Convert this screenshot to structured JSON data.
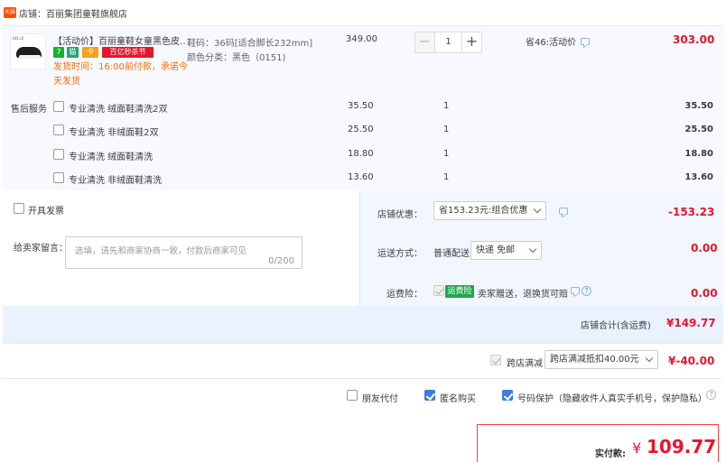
{
  "store": {
    "icon_text": "天猫",
    "label": "店铺：百丽集团童鞋旗舰店"
  },
  "item": {
    "title": "【活动价】百丽童鞋女童黑色皮…",
    "brand_mark": "BELLE",
    "badges": [
      "7",
      "猫",
      "卡",
      "百亿秒杀节"
    ],
    "ship_note": "发货时间：16:00前付款，承诺今天发货",
    "sku_size": "鞋码：36码[适合脚长232mm]",
    "sku_color": "颜色分类：黑色（0151)",
    "unit_price": "349.00",
    "quantity": "1",
    "discount": "省46:活动价",
    "total": "303.00"
  },
  "services": {
    "label": "售后服务",
    "rows": [
      {
        "name": "专业清洗 绒面鞋清洗2双",
        "price": "35.50",
        "qty": "1",
        "total": "35.50"
      },
      {
        "name": "专业清洗 非绒面鞋2双",
        "price": "25.50",
        "qty": "1",
        "total": "25.50"
      },
      {
        "name": "专业清洗 绒面鞋清洗",
        "price": "18.80",
        "qty": "1",
        "total": "18.80"
      },
      {
        "name": "专业清洗 非绒面鞋清洗",
        "price": "13.60",
        "qty": "1",
        "total": "13.60"
      }
    ]
  },
  "options": {
    "invoice_label": "开具发票",
    "message_label": "给卖家留言：",
    "message_placeholder": "选填，请先和商家协商一致，付款后商家可见",
    "message_count": "0/200",
    "shop_discount_label": "店铺优惠：",
    "shop_discount_value": "省153.23元:组合优惠",
    "shop_discount_amount": "-153.23",
    "shipping_label": "运送方式：",
    "shipping_type": "普通配送",
    "shipping_value": "快递 免邮",
    "shipping_amount": "0.00",
    "freight_ins_label": "运费险：",
    "freight_ins_tag": "运费险",
    "freight_ins_text": "卖家赠送，退换货可赔",
    "freight_ins_amount": "0.00",
    "subtotal_label": "店铺合计(含运费)",
    "subtotal_amount": "¥149.77"
  },
  "cross_store": {
    "label": "跨店满减",
    "value": "跨店满减抵扣40.00元",
    "amount": "¥-40.00"
  },
  "extras": {
    "friend_pay": "朋友代付",
    "anonymous": "匿名购买",
    "privacy": "号码保护（隐藏收件人真实手机号，保护隐私）"
  },
  "payment": {
    "label": "实付款:",
    "yen": "¥",
    "amount": "109.77"
  },
  "colors": {
    "accent_red": "#e3172c",
    "accent_orange": "#ff6a00",
    "check_blue": "#3b7cdd"
  }
}
